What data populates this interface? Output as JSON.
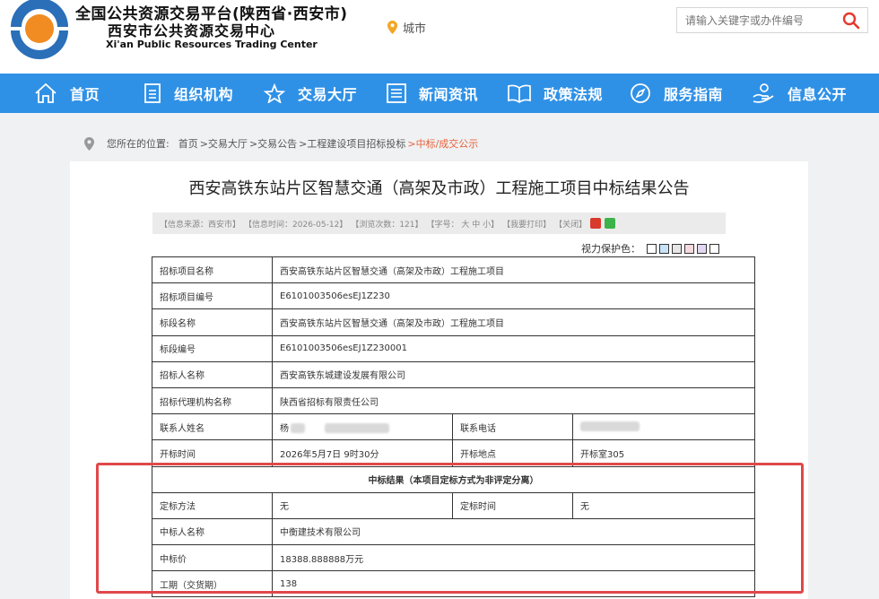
{
  "header": {
    "platform_title": "全国公共资源交易平台(陕西省·西安市)",
    "center_name": "西安市公共资源交易中心",
    "center_name_en": "Xi'an Public Resources Trading Center",
    "city_label": "城市",
    "search_placeholder": "请输入关键字或办件编号"
  },
  "nav": {
    "items": [
      {
        "label": "首页",
        "icon": "home-icon"
      },
      {
        "label": "组织机构",
        "icon": "document-icon"
      },
      {
        "label": "交易大厅",
        "icon": "star-icon"
      },
      {
        "label": "新闻资讯",
        "icon": "list-icon"
      },
      {
        "label": "政策法规",
        "icon": "book-icon"
      },
      {
        "label": "服务指南",
        "icon": "compass-icon"
      },
      {
        "label": "信息公开",
        "icon": "hand-icon"
      }
    ]
  },
  "breadcrumb": {
    "prefix": "您所在的位置:",
    "items": [
      "首页",
      ">交易大厅",
      ">交易公告",
      ">工程建设项目招标投标",
      ">中标/成交公示"
    ]
  },
  "article": {
    "title": "西安高铁东站片区智慧交通（高架及市政）工程施工项目中标结果公告",
    "info": {
      "source": "【信息来源：西安市】",
      "time": "【信息时间：2026-05-12】",
      "views": "【浏览次数：121】",
      "font_size": "【字号：  大  中  小】",
      "print": "【我要打印】",
      "close": "【关闭】"
    },
    "vision_label": "视力保护色：",
    "vision_colors": [
      "#ffffff",
      "#c7e3f5",
      "#e6e6e6",
      "#f5d9de",
      "#e3d6f0",
      "#ffffff"
    ]
  },
  "table": {
    "project_name_label": "招标项目名称",
    "project_name": "西安高铁东站片区智慧交通（高架及市政）工程施工项目",
    "project_no_label": "招标项目编号",
    "project_no": "E6101003506esEJ1Z230",
    "section_name_label": "标段名称",
    "section_name": "西安高铁东站片区智慧交通（高架及市政）工程施工项目",
    "section_no_label": "标段编号",
    "section_no": "E6101003506esEJ1Z230001",
    "tenderer_label": "招标人名称",
    "tenderer": "西安高铁东城建设发展有限公司",
    "agency_label": "招标代理机构名称",
    "agency": "陕西省招标有限责任公司",
    "contact_label": "联系人姓名",
    "contact": "杨",
    "phone_label": "联系电话",
    "open_time_label": "开标时间",
    "open_time": "2026年5月7日  9时30分",
    "open_place_label": "开标地点",
    "open_place": "开标室305",
    "result_header": "中标结果（本项目定标方式为非评定分离）",
    "method_label": "定标方法",
    "method": "无",
    "decide_time_label": "定标时间",
    "decide_time": "无",
    "winner_label": "中标人名称",
    "winner": "中衡建技术有限公司",
    "price_label": "中标价",
    "price": "18388.888888万元",
    "period_label": "工期（交货期）",
    "period": "138"
  }
}
